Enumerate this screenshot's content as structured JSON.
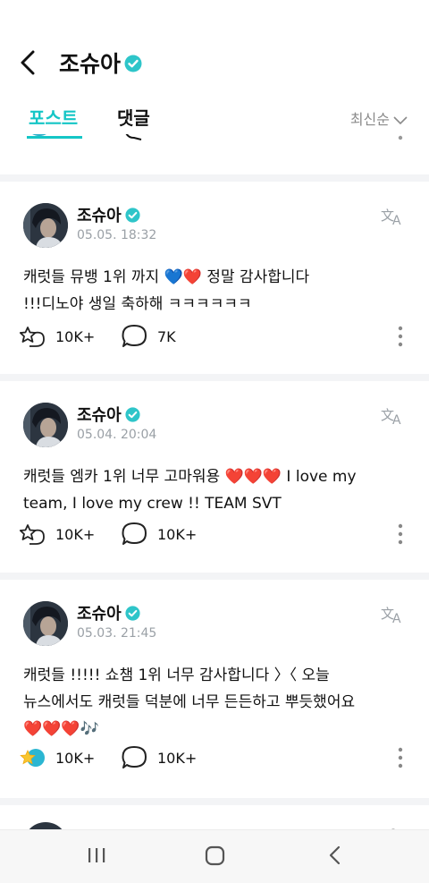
{
  "header": {
    "title": "조슈아",
    "back_icon": "chevron-left-icon",
    "verified_color": "#2ec5c9"
  },
  "tabs": [
    {
      "label": "포스트",
      "active": true
    },
    {
      "label": "댓글",
      "active": false
    }
  ],
  "sort": {
    "label": "최신순"
  },
  "accent_color": "#15c6c6",
  "posts": [
    {
      "author": "조슈아",
      "date": "05.05. 18:32",
      "line1": "캐럿들 뮤뱅 1위 까지 ",
      "line1_emoji": "💙❤️",
      "line1_tail": " 정말 감사합니다",
      "line2": "!!!디노야 생일 축하해 ㅋㅋㅋㅋㅋㅋ",
      "reactions": "10K+",
      "comments": "7K"
    },
    {
      "author": "조슈아",
      "date": "05.04. 20:04",
      "line1": "캐럿들 엠카 1위 너무 고마워용 ",
      "line1_emoji": "❤️❤️❤️",
      "line1_tail": " I love my",
      "line2": "team, I love my crew !! TEAM SVT",
      "reactions": "10K+",
      "comments": "10K+"
    },
    {
      "author": "조슈아",
      "date": "05.03. 21:45",
      "line1": "캐럿들 !!!!! 쇼챔 1위 너무 감사합니다 〉〈 오늘",
      "line2": "뉴스에서도 캐럿들 덕분에 너무 든든하고 뿌듯했어요",
      "line3_emoji": "❤️❤️❤️🎶",
      "reactions": "10K+",
      "comments": "10K+"
    }
  ],
  "navbar": {
    "recent_icon": "recent-apps-icon",
    "home_icon": "home-icon",
    "back_icon": "back-icon"
  }
}
